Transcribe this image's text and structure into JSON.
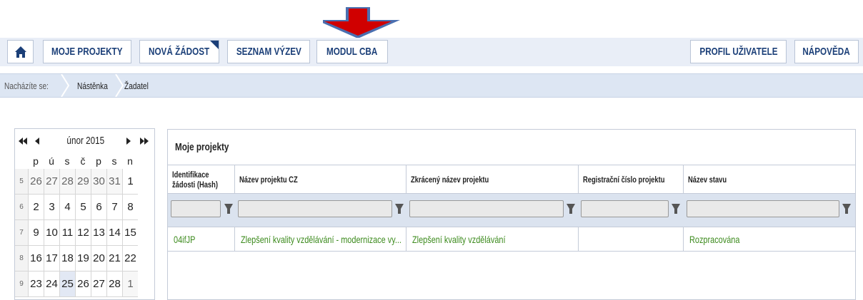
{
  "nav": {
    "home_icon": "home-icon",
    "items": [
      {
        "label": "MOJE PROJEKTY"
      },
      {
        "label": "NOVÁ ŽÁDOST"
      },
      {
        "label": "SEZNAM VÝZEV"
      },
      {
        "label": "MODUL CBA"
      },
      {
        "label": "PROFIL UŽIVATELE"
      },
      {
        "label": "NÁPOVĚDA"
      }
    ]
  },
  "breadcrumb": {
    "prefix": "Nacházíte se:",
    "items": [
      "Nástěnka",
      "Žadatel"
    ]
  },
  "calendar": {
    "title": "únor 2015",
    "nav_first": "⏮",
    "nav_prev": "◀",
    "nav_next": "▶",
    "nav_last": "⏭",
    "day_names": [
      "p",
      "ú",
      "s",
      "č",
      "p",
      "s",
      "n"
    ],
    "weeks": [
      {
        "num": "5",
        "days": [
          "26",
          "27",
          "28",
          "29",
          "30",
          "31",
          "1"
        ]
      },
      {
        "num": "6",
        "days": [
          "2",
          "3",
          "4",
          "5",
          "6",
          "7",
          "8"
        ]
      },
      {
        "num": "7",
        "days": [
          "9",
          "10",
          "11",
          "12",
          "13",
          "14",
          "15"
        ]
      },
      {
        "num": "8",
        "days": [
          "16",
          "17",
          "18",
          "19",
          "20",
          "21",
          "22"
        ]
      },
      {
        "num": "9",
        "days": [
          "23",
          "24",
          "25",
          "26",
          "27",
          "28",
          "1"
        ]
      }
    ]
  },
  "projects": {
    "title": "Moje projekty",
    "columns": [
      {
        "label": "Identifikace žádosti (Hash)"
      },
      {
        "label": "Název projektu CZ"
      },
      {
        "label": "Zkrácený název projektu"
      },
      {
        "label": "Registrační číslo projektu"
      },
      {
        "label": "Název stavu"
      }
    ],
    "rows": [
      [
        "04ifJP",
        "Zlepšení kvality vzdělávání - modernizace vy...",
        "Zlepšení kvality vzdělávání",
        "",
        "Rozpracována"
      ]
    ]
  },
  "colors": {
    "accent": "#1b3f78",
    "link_green": "#3d8b1e",
    "arrow_red": "#d00000",
    "arrow_blue": "#4a6fb0"
  }
}
